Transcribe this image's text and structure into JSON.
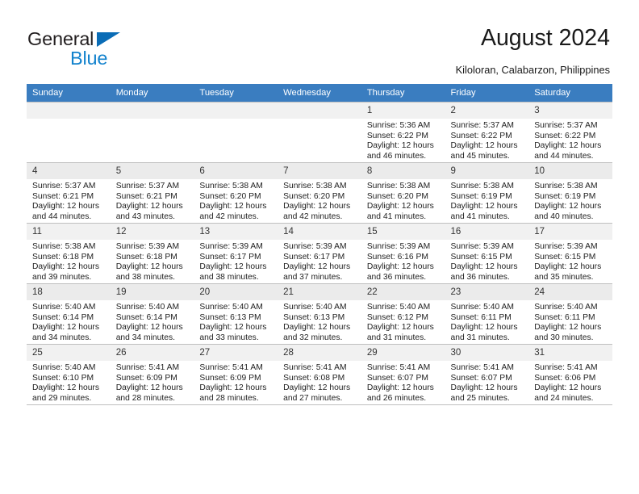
{
  "brand": {
    "name_part1": "General",
    "name_part2": "Blue",
    "triangle_color": "#0a6cb6",
    "blue_color": "#1282cd"
  },
  "header": {
    "title": "August 2024",
    "subtitle": "Kiloloran, Calabarzon, Philippines",
    "accent_color": "#3a7dc0"
  },
  "weekdays": [
    "Sunday",
    "Monday",
    "Tuesday",
    "Wednesday",
    "Thursday",
    "Friday",
    "Saturday"
  ],
  "weeks": [
    [
      {
        "day": "",
        "sunrise": "",
        "sunset": "",
        "daylight1": "",
        "daylight2": ""
      },
      {
        "day": "",
        "sunrise": "",
        "sunset": "",
        "daylight1": "",
        "daylight2": ""
      },
      {
        "day": "",
        "sunrise": "",
        "sunset": "",
        "daylight1": "",
        "daylight2": ""
      },
      {
        "day": "",
        "sunrise": "",
        "sunset": "",
        "daylight1": "",
        "daylight2": ""
      },
      {
        "day": "1",
        "sunrise": "Sunrise: 5:36 AM",
        "sunset": "Sunset: 6:22 PM",
        "daylight1": "Daylight: 12 hours",
        "daylight2": "and 46 minutes."
      },
      {
        "day": "2",
        "sunrise": "Sunrise: 5:37 AM",
        "sunset": "Sunset: 6:22 PM",
        "daylight1": "Daylight: 12 hours",
        "daylight2": "and 45 minutes."
      },
      {
        "day": "3",
        "sunrise": "Sunrise: 5:37 AM",
        "sunset": "Sunset: 6:22 PM",
        "daylight1": "Daylight: 12 hours",
        "daylight2": "and 44 minutes."
      }
    ],
    [
      {
        "day": "4",
        "sunrise": "Sunrise: 5:37 AM",
        "sunset": "Sunset: 6:21 PM",
        "daylight1": "Daylight: 12 hours",
        "daylight2": "and 44 minutes."
      },
      {
        "day": "5",
        "sunrise": "Sunrise: 5:37 AM",
        "sunset": "Sunset: 6:21 PM",
        "daylight1": "Daylight: 12 hours",
        "daylight2": "and 43 minutes."
      },
      {
        "day": "6",
        "sunrise": "Sunrise: 5:38 AM",
        "sunset": "Sunset: 6:20 PM",
        "daylight1": "Daylight: 12 hours",
        "daylight2": "and 42 minutes."
      },
      {
        "day": "7",
        "sunrise": "Sunrise: 5:38 AM",
        "sunset": "Sunset: 6:20 PM",
        "daylight1": "Daylight: 12 hours",
        "daylight2": "and 42 minutes."
      },
      {
        "day": "8",
        "sunrise": "Sunrise: 5:38 AM",
        "sunset": "Sunset: 6:20 PM",
        "daylight1": "Daylight: 12 hours",
        "daylight2": "and 41 minutes."
      },
      {
        "day": "9",
        "sunrise": "Sunrise: 5:38 AM",
        "sunset": "Sunset: 6:19 PM",
        "daylight1": "Daylight: 12 hours",
        "daylight2": "and 41 minutes."
      },
      {
        "day": "10",
        "sunrise": "Sunrise: 5:38 AM",
        "sunset": "Sunset: 6:19 PM",
        "daylight1": "Daylight: 12 hours",
        "daylight2": "and 40 minutes."
      }
    ],
    [
      {
        "day": "11",
        "sunrise": "Sunrise: 5:38 AM",
        "sunset": "Sunset: 6:18 PM",
        "daylight1": "Daylight: 12 hours",
        "daylight2": "and 39 minutes."
      },
      {
        "day": "12",
        "sunrise": "Sunrise: 5:39 AM",
        "sunset": "Sunset: 6:18 PM",
        "daylight1": "Daylight: 12 hours",
        "daylight2": "and 38 minutes."
      },
      {
        "day": "13",
        "sunrise": "Sunrise: 5:39 AM",
        "sunset": "Sunset: 6:17 PM",
        "daylight1": "Daylight: 12 hours",
        "daylight2": "and 38 minutes."
      },
      {
        "day": "14",
        "sunrise": "Sunrise: 5:39 AM",
        "sunset": "Sunset: 6:17 PM",
        "daylight1": "Daylight: 12 hours",
        "daylight2": "and 37 minutes."
      },
      {
        "day": "15",
        "sunrise": "Sunrise: 5:39 AM",
        "sunset": "Sunset: 6:16 PM",
        "daylight1": "Daylight: 12 hours",
        "daylight2": "and 36 minutes."
      },
      {
        "day": "16",
        "sunrise": "Sunrise: 5:39 AM",
        "sunset": "Sunset: 6:15 PM",
        "daylight1": "Daylight: 12 hours",
        "daylight2": "and 36 minutes."
      },
      {
        "day": "17",
        "sunrise": "Sunrise: 5:39 AM",
        "sunset": "Sunset: 6:15 PM",
        "daylight1": "Daylight: 12 hours",
        "daylight2": "and 35 minutes."
      }
    ],
    [
      {
        "day": "18",
        "sunrise": "Sunrise: 5:40 AM",
        "sunset": "Sunset: 6:14 PM",
        "daylight1": "Daylight: 12 hours",
        "daylight2": "and 34 minutes."
      },
      {
        "day": "19",
        "sunrise": "Sunrise: 5:40 AM",
        "sunset": "Sunset: 6:14 PM",
        "daylight1": "Daylight: 12 hours",
        "daylight2": "and 34 minutes."
      },
      {
        "day": "20",
        "sunrise": "Sunrise: 5:40 AM",
        "sunset": "Sunset: 6:13 PM",
        "daylight1": "Daylight: 12 hours",
        "daylight2": "and 33 minutes."
      },
      {
        "day": "21",
        "sunrise": "Sunrise: 5:40 AM",
        "sunset": "Sunset: 6:13 PM",
        "daylight1": "Daylight: 12 hours",
        "daylight2": "and 32 minutes."
      },
      {
        "day": "22",
        "sunrise": "Sunrise: 5:40 AM",
        "sunset": "Sunset: 6:12 PM",
        "daylight1": "Daylight: 12 hours",
        "daylight2": "and 31 minutes."
      },
      {
        "day": "23",
        "sunrise": "Sunrise: 5:40 AM",
        "sunset": "Sunset: 6:11 PM",
        "daylight1": "Daylight: 12 hours",
        "daylight2": "and 31 minutes."
      },
      {
        "day": "24",
        "sunrise": "Sunrise: 5:40 AM",
        "sunset": "Sunset: 6:11 PM",
        "daylight1": "Daylight: 12 hours",
        "daylight2": "and 30 minutes."
      }
    ],
    [
      {
        "day": "25",
        "sunrise": "Sunrise: 5:40 AM",
        "sunset": "Sunset: 6:10 PM",
        "daylight1": "Daylight: 12 hours",
        "daylight2": "and 29 minutes."
      },
      {
        "day": "26",
        "sunrise": "Sunrise: 5:41 AM",
        "sunset": "Sunset: 6:09 PM",
        "daylight1": "Daylight: 12 hours",
        "daylight2": "and 28 minutes."
      },
      {
        "day": "27",
        "sunrise": "Sunrise: 5:41 AM",
        "sunset": "Sunset: 6:09 PM",
        "daylight1": "Daylight: 12 hours",
        "daylight2": "and 28 minutes."
      },
      {
        "day": "28",
        "sunrise": "Sunrise: 5:41 AM",
        "sunset": "Sunset: 6:08 PM",
        "daylight1": "Daylight: 12 hours",
        "daylight2": "and 27 minutes."
      },
      {
        "day": "29",
        "sunrise": "Sunrise: 5:41 AM",
        "sunset": "Sunset: 6:07 PM",
        "daylight1": "Daylight: 12 hours",
        "daylight2": "and 26 minutes."
      },
      {
        "day": "30",
        "sunrise": "Sunrise: 5:41 AM",
        "sunset": "Sunset: 6:07 PM",
        "daylight1": "Daylight: 12 hours",
        "daylight2": "and 25 minutes."
      },
      {
        "day": "31",
        "sunrise": "Sunrise: 5:41 AM",
        "sunset": "Sunset: 6:06 PM",
        "daylight1": "Daylight: 12 hours",
        "daylight2": "and 24 minutes."
      }
    ]
  ]
}
